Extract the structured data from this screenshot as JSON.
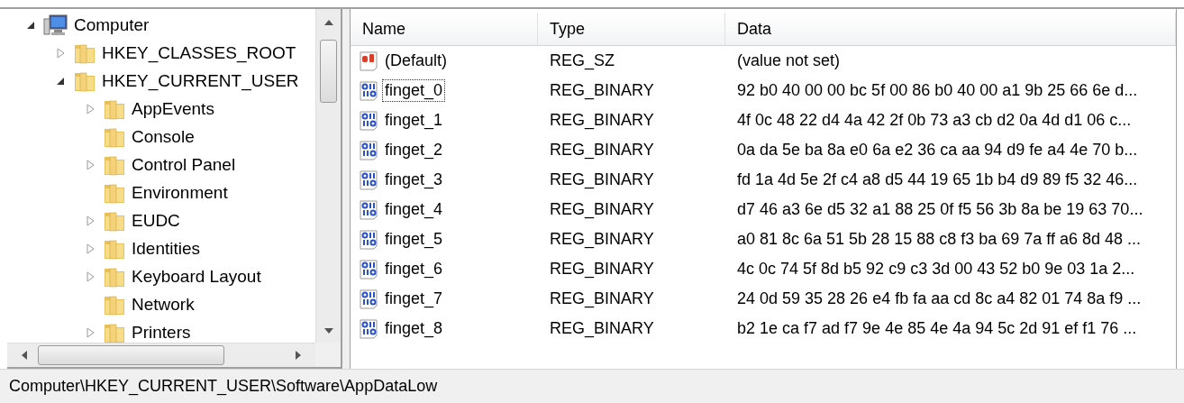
{
  "tree": [
    {
      "label": "Computer",
      "kind": "computer",
      "expanded": true,
      "children": [
        {
          "label": "HKEY_CLASSES_ROOT",
          "kind": "key",
          "expanded": false
        },
        {
          "label": "HKEY_CURRENT_USER",
          "kind": "key",
          "expanded": true,
          "children": [
            {
              "label": "AppEvents",
              "kind": "key",
              "expanded": false
            },
            {
              "label": "Console",
              "kind": "leaf_key",
              "expanded": false
            },
            {
              "label": "Control Panel",
              "kind": "key",
              "expanded": false
            },
            {
              "label": "Environment",
              "kind": "leaf_key",
              "expanded": false
            },
            {
              "label": "EUDC",
              "kind": "key",
              "expanded": false
            },
            {
              "label": "Identities",
              "kind": "key",
              "expanded": false
            },
            {
              "label": "Keyboard Layout",
              "kind": "key",
              "expanded": false
            },
            {
              "label": "Network",
              "kind": "leaf_key",
              "expanded": false
            },
            {
              "label": "Printers",
              "kind": "key",
              "expanded": false
            }
          ]
        }
      ]
    }
  ],
  "table": {
    "columns": [
      "Name",
      "Type",
      "Data"
    ],
    "rows": [
      {
        "kind": "string",
        "name": "(Default)",
        "type": "REG_SZ",
        "data": "(value not set)",
        "focused": false
      },
      {
        "kind": "binary",
        "name": "finget_0",
        "type": "REG_BINARY",
        "data": "92 b0 40 00 00 bc 5f 00 86 b0 40 00 a1 9b 25 66 6e d...",
        "focused": true
      },
      {
        "kind": "binary",
        "name": "finget_1",
        "type": "REG_BINARY",
        "data": "4f 0c 48 22 d4 4a 42 2f 0b 73 a3 cb d2 0a 4d d1 06 c...",
        "focused": false
      },
      {
        "kind": "binary",
        "name": "finget_2",
        "type": "REG_BINARY",
        "data": "0a da 5e ba 8a e0 6a e2 36 ca aa 94 d9 fe a4 4e 70 b...",
        "focused": false
      },
      {
        "kind": "binary",
        "name": "finget_3",
        "type": "REG_BINARY",
        "data": "fd 1a 4d 5e 2f c4 a8 d5 44 19 65 1b b4 d9 89 f5 32 46...",
        "focused": false
      },
      {
        "kind": "binary",
        "name": "finget_4",
        "type": "REG_BINARY",
        "data": "d7 46 a3 6e d5 32 a1 88 25 0f f5 56 3b 8a be 19 63 70...",
        "focused": false
      },
      {
        "kind": "binary",
        "name": "finget_5",
        "type": "REG_BINARY",
        "data": "a0 81 8c 6a 51 5b 28 15 88 c8 f3 ba 69 7a ff a6 8d 48 ...",
        "focused": false
      },
      {
        "kind": "binary",
        "name": "finget_6",
        "type": "REG_BINARY",
        "data": "4c 0c 74 5f 8d b5 92 c9 c3 3d 00 43 52 b0 9e 03 1a 2...",
        "focused": false
      },
      {
        "kind": "binary",
        "name": "finget_7",
        "type": "REG_BINARY",
        "data": "24 0d 59 35 28 26 e4 fb fa aa cd 8c a4 82 01 74 8a f9 ...",
        "focused": false
      },
      {
        "kind": "binary",
        "name": "finget_8",
        "type": "REG_BINARY",
        "data": "b2 1e ca f7 ad f7 9e 4e 85 4e 4a 94 5c 2d 91 ef f1 76 ...",
        "focused": false
      }
    ]
  },
  "status_bar": "Computer\\HKEY_CURRENT_USER\\Software\\AppDataLow"
}
